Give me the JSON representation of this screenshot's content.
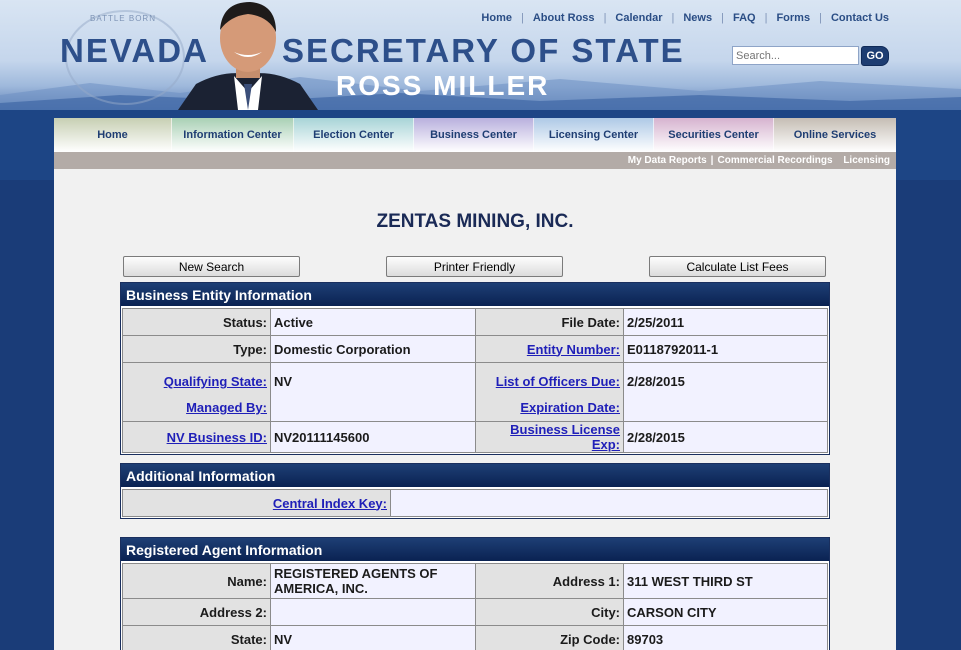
{
  "header": {
    "title_left": "NEVADA",
    "title_right": "SECRETARY OF STATE",
    "subtitle": "ROSS MILLER",
    "seal_text": "BATTLE BORN",
    "top_links": [
      "Home",
      "About Ross",
      "Calendar",
      "News",
      "FAQ",
      "Forms",
      "Contact Us"
    ],
    "search_placeholder": "Search...",
    "go_label": "GO"
  },
  "nav": {
    "tabs": [
      {
        "label": "Home",
        "color": "#c7cfb3"
      },
      {
        "label": "Information Center",
        "color": "#a9d0b5"
      },
      {
        "label": "Election Center",
        "color": "#a8d4d7"
      },
      {
        "label": "Business Center",
        "color": "#b9b0dd"
      },
      {
        "label": "Licensing Center",
        "color": "#aec9e6"
      },
      {
        "label": "Securities Center",
        "color": "#d6b3cf"
      },
      {
        "label": "Online Services",
        "color": "#c5bdb4"
      }
    ],
    "sublinks": [
      "My Data Reports",
      "Commercial Recordings",
      "Licensing"
    ]
  },
  "page": {
    "entity_name": "ZENTAS MINING, INC.",
    "buttons": [
      "New Search",
      "Printer Friendly",
      "Calculate List Fees"
    ]
  },
  "business_entity": {
    "title": "Business Entity Information",
    "status_label": "Status:",
    "status": "Active",
    "file_date_label": "File Date:",
    "file_date": "2/25/2011",
    "type_label": "Type:",
    "type": "Domestic Corporation",
    "entity_number_label": "Entity Number:",
    "entity_number": "E0118792011-1",
    "qualifying_state_label": "Qualifying State:",
    "qualifying_state": "NV",
    "officers_due_label": "List of Officers Due:",
    "officers_due": "2/28/2015",
    "managed_by_label": "Managed By:",
    "managed_by": "",
    "expiration_label": "Expiration Date:",
    "expiration": "",
    "nv_business_id_label": "NV Business ID:",
    "nv_business_id": "NV20111145600",
    "license_exp_label": "Business License Exp:",
    "license_exp": "2/28/2015"
  },
  "additional": {
    "title": "Additional Information",
    "cik_label": "Central Index Key:",
    "cik": ""
  },
  "registered_agent": {
    "title": "Registered Agent Information",
    "name_label": "Name:",
    "name": "REGISTERED AGENTS OF AMERICA, INC.",
    "address1_label": "Address 1:",
    "address1": "311 WEST THIRD ST",
    "address2_label": "Address 2:",
    "address2": "",
    "city_label": "City:",
    "city": "CARSON CITY",
    "state_label": "State:",
    "state": "NV",
    "zip_label": "Zip Code:",
    "zip": "89703"
  }
}
